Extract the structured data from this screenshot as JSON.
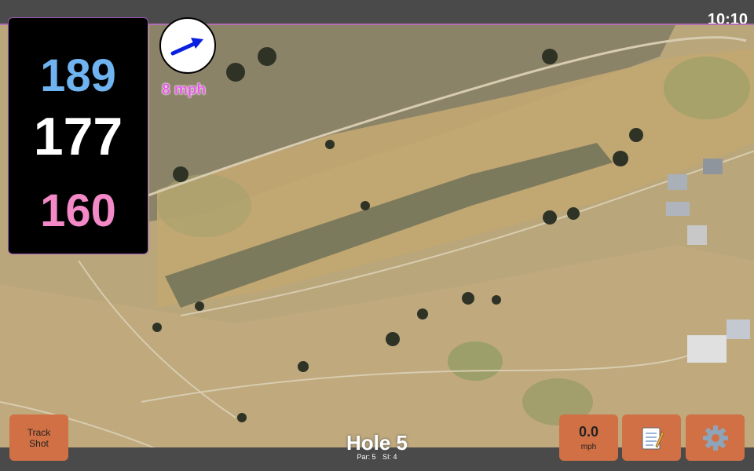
{
  "status_bar": {
    "time": "10:10"
  },
  "distances": {
    "back": "189",
    "middle": "177",
    "front": "160"
  },
  "wind": {
    "speed_label": "8 mph",
    "direction_icon": "arrow-icon"
  },
  "buttons": {
    "track_shot_line1": "Track",
    "track_shot_line2": "Shot",
    "wind_value": "0.0",
    "wind_unit": "mph",
    "notes_icon": "notepad-icon",
    "settings_icon": "gear-icon"
  },
  "hole": {
    "title": "Hole 5",
    "par": "Par: 5",
    "si": "SI: 4"
  },
  "colors": {
    "back_distance": "#6fb3f0",
    "middle_distance": "#ffffff",
    "front_distance": "#f389c6",
    "button_bg": "#d07044",
    "wind_text": "#e65ce6"
  }
}
